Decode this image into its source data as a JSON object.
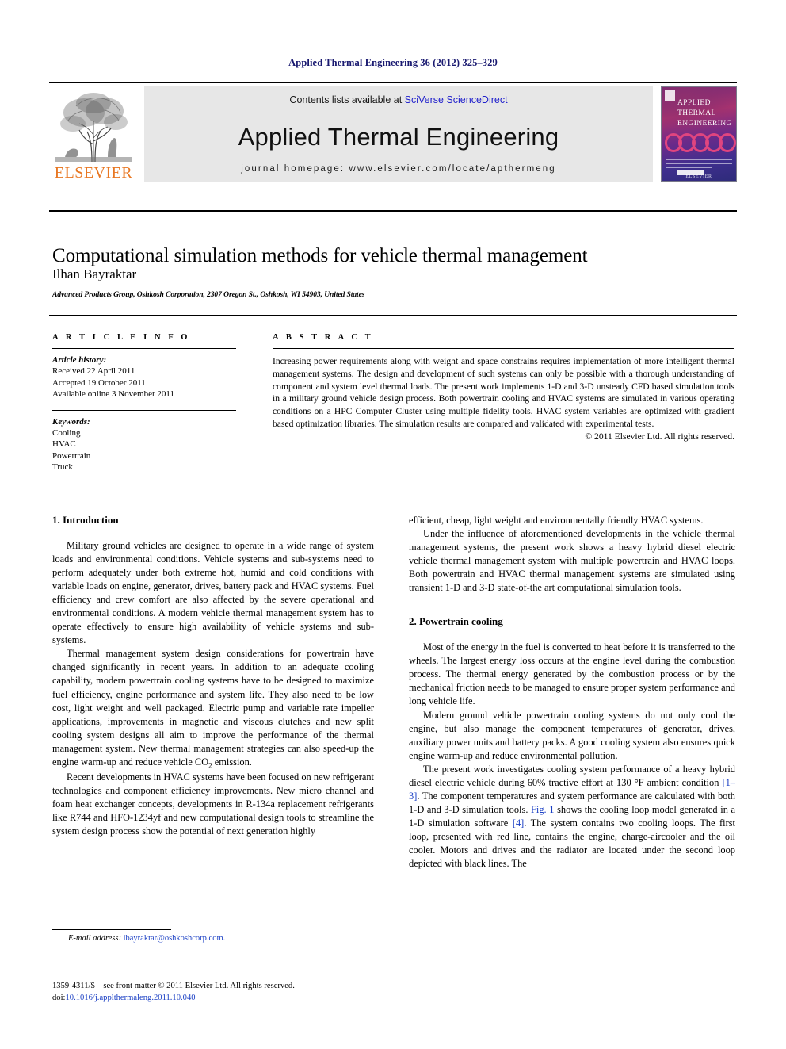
{
  "running_head": "Applied Thermal Engineering 36 (2012) 325–329",
  "banner": {
    "publisher_name": "ELSEVIER",
    "publisher_logo_icon": "elsevier-tree-icon",
    "contents_prefix": "Contents lists available at ",
    "contents_link": "SciVerse ScienceDirect",
    "journal_title": "Applied Thermal Engineering",
    "homepage": "journal homepage: www.elsevier.com/locate/apthermeng",
    "cover": {
      "title_line1": "APPLIED",
      "title_line2": "THERMAL",
      "title_line3": "ENGINEERING",
      "footer": "ELSEVIER"
    },
    "accent_orange": "#E87722",
    "link_blue": "#2222cc"
  },
  "article": {
    "title": "Computational simulation methods for vehicle thermal management",
    "author": "Ilhan Bayraktar",
    "affiliation": "Advanced Products Group, Oshkosh Corporation, 2307 Oregon St., Oshkosh, WI 54903, United States"
  },
  "article_info": {
    "heading": "A R T I C L E   I N F O",
    "history_label": "Article history:",
    "history": [
      "Received 22 April 2011",
      "Accepted 19 October 2011",
      "Available online 3 November 2011"
    ],
    "keywords_label": "Keywords:",
    "keywords": [
      "Cooling",
      "HVAC",
      "Powertrain",
      "Truck"
    ]
  },
  "abstract": {
    "heading": "A B S T R A C T",
    "text": "Increasing power requirements along with weight and space constrains requires implementation of more intelligent thermal management systems. The design and development of such systems can only be possible with a thorough understanding of component and system level thermal loads. The present work implements 1-D and 3-D unsteady CFD based simulation tools in a military ground vehicle design process. Both powertrain cooling and HVAC systems are simulated in various operating conditions on a HPC Computer Cluster using multiple fidelity tools. HVAC system variables are optimized with gradient based optimization libraries. The simulation results are compared and validated with experimental tests.",
    "copyright": "© 2011 Elsevier Ltd. All rights reserved."
  },
  "body": {
    "section1_heading": "1.  Introduction",
    "s1_p1": "Military ground vehicles are designed to operate in a wide range of system loads and environmental conditions. Vehicle systems and sub-systems need to perform adequately under both extreme hot, humid and cold conditions with variable loads on engine, generator, drives, battery pack and HVAC systems. Fuel efficiency and crew comfort are also affected by the severe operational and environmental conditions. A modern vehicle thermal management system has to operate effectively to ensure high availability of vehicle systems and sub-systems.",
    "s1_p2_a": "Thermal management system design considerations for powertrain have changed significantly in recent years. In addition to an adequate cooling capability, modern powertrain cooling systems have to be designed to maximize fuel efficiency, engine performance and system life. They also need to be low cost, light weight and well packaged. Electric pump and variable rate impeller applications, improvements in magnetic and viscous clutches and new split cooling system designs all aim to improve the performance of the thermal management system. New thermal management strategies can also speed-up the engine warm-up and reduce vehicle CO",
    "s1_p2_sub": "2",
    "s1_p2_b": " emission.",
    "s1_p3": "Recent developments in HVAC systems have been focused on new refrigerant technologies and component efficiency improvements. New micro channel and foam heat exchanger concepts, developments in R-134a replacement refrigerants like R744 and HFO-1234yf and new computational design tools to streamline the system design process show the potential of next generation highly",
    "s1_p3_cont": "efficient, cheap, light weight and environmentally friendly HVAC systems.",
    "s1_p4": "Under the influence of aforementioned developments in the vehicle thermal management systems, the present work shows a heavy hybrid diesel electric vehicle thermal management system with multiple powertrain and HVAC loops. Both powertrain and HVAC thermal management systems are simulated using transient 1-D and 3-D state-of-the art computational simulation tools.",
    "section2_heading": "2.  Powertrain cooling",
    "s2_p1": "Most of the energy in the fuel is converted to heat before it is transferred to the wheels. The largest energy loss occurs at the engine level during the combustion process. The thermal energy generated by the combustion process or by the mechanical friction needs to be managed to ensure proper system performance and long vehicle life.",
    "s2_p2": "Modern ground vehicle powertrain cooling systems do not only cool the engine, but also manage the component temperatures of generator, drives, auxiliary power units and battery packs. A good cooling system also ensures quick engine warm-up and reduce environmental pollution.",
    "s2_p3_a": "The present work investigates cooling system performance of a heavy hybrid diesel electric vehicle during 60% tractive effort at 130 °F ambient condition ",
    "s2_p3_ref1": "[1–3]",
    "s2_p3_b": ". The component temperatures and system performance are calculated with both 1-D and 3-D simulation tools. ",
    "s2_p3_figref": "Fig. 1",
    "s2_p3_c": " shows the cooling loop model generated in a 1-D simulation software ",
    "s2_p3_ref2": "[4]",
    "s2_p3_d": ". The system contains two cooling loops. The first loop, presented with red line, contains the engine, charge-aircooler and the oil cooler. Motors and drives and the radiator are located under the second loop depicted with black lines. The"
  },
  "footnote": {
    "email_label": "E-mail address:",
    "email": "ibayraktar@oshkoshcorp.com."
  },
  "footer": {
    "line1": "1359-4311/$ – see front matter © 2011 Elsevier Ltd. All rights reserved.",
    "doi_label": "doi:",
    "doi_value": "10.1016/j.applthermaleng.2011.10.040"
  }
}
